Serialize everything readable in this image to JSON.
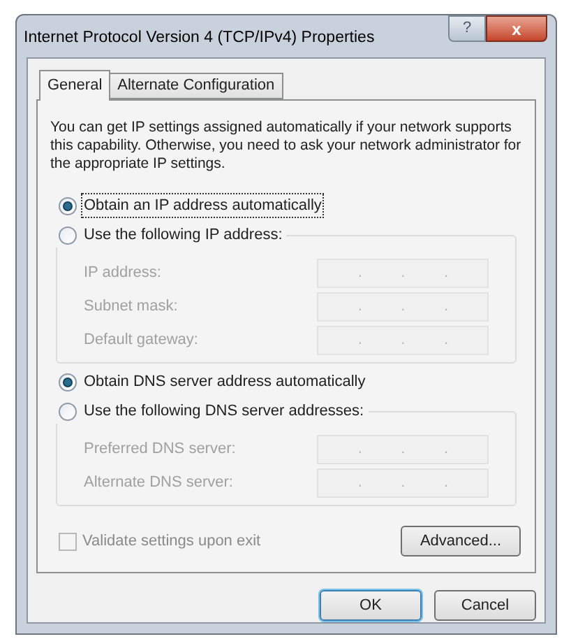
{
  "window": {
    "title": "Internet Protocol Version 4 (TCP/IPv4) Properties",
    "help_button": "?",
    "close_button": "x"
  },
  "tabs": [
    {
      "label": "General",
      "selected": true
    },
    {
      "label": "Alternate Configuration",
      "selected": false
    }
  ],
  "intro": "You can get IP settings assigned automatically if your network supports this capability. Otherwise, you need to ask your network administrator for the appropriate IP settings.",
  "ip_group": {
    "options": [
      {
        "label": "Obtain an IP address automatically",
        "selected": true,
        "focused": true
      },
      {
        "label": "Use the following IP address:",
        "selected": false,
        "focused": false
      }
    ],
    "fields": [
      {
        "label": "IP address:",
        "disabled": true,
        "dots": [
          ".",
          ".",
          "."
        ]
      },
      {
        "label": "Subnet mask:",
        "disabled": true,
        "dots": [
          ".",
          ".",
          "."
        ]
      },
      {
        "label": "Default gateway:",
        "disabled": true,
        "dots": [
          ".",
          ".",
          "."
        ]
      }
    ]
  },
  "dns_group": {
    "options": [
      {
        "label": "Obtain DNS server address automatically",
        "selected": true,
        "focused": false
      },
      {
        "label": "Use the following DNS server addresses:",
        "selected": false,
        "focused": false
      }
    ],
    "fields": [
      {
        "label": "Preferred DNS server:",
        "disabled": true,
        "dots": [
          ".",
          ".",
          "."
        ]
      },
      {
        "label": "Alternate DNS server:",
        "disabled": true,
        "dots": [
          ".",
          ".",
          "."
        ]
      }
    ]
  },
  "validate": {
    "label": "Validate settings upon exit",
    "checked": false,
    "disabled": true
  },
  "advanced_button": "Advanced...",
  "buttons": [
    {
      "label": "OK",
      "default": true
    },
    {
      "label": "Cancel",
      "default": false
    }
  ]
}
